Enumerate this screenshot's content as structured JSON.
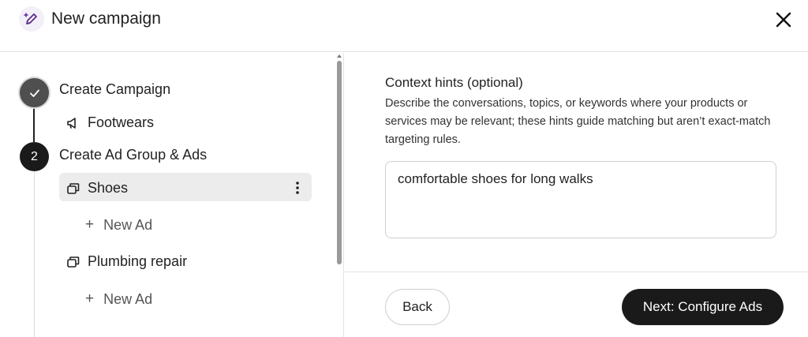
{
  "header": {
    "title": "New campaign",
    "icon": "pencil-sparkle-icon",
    "close_icon": "close-icon"
  },
  "steps": [
    {
      "label": "Create Campaign",
      "status": "completed",
      "indicator": "✓"
    },
    {
      "label": "Create Ad Group & Ads",
      "status": "current",
      "indicator": "2"
    }
  ],
  "tree": {
    "campaign": {
      "label": "Footwears",
      "icon": "megaphone-icon"
    },
    "ad_groups": [
      {
        "label": "Shoes",
        "icon": "ad-group-icon",
        "selected": true,
        "new_ad_label": "New Ad"
      },
      {
        "label": "Plumbing repair",
        "icon": "ad-group-icon",
        "selected": false,
        "new_ad_label": "New Ad"
      }
    ]
  },
  "context_hints": {
    "label": "Context hints (optional)",
    "description": "Describe the conversations, topics, or keywords where your products or services may be relevant; these hints guide matching but aren’t exact-match targeting rules.",
    "value": "comfortable shoes for long walks"
  },
  "footer": {
    "back_label": "Back",
    "next_label": "Next: Configure Ads"
  },
  "colors": {
    "primary": "#1a1a1a",
    "selected_row": "#ececec",
    "icon_accent": "#5b2d8e"
  }
}
